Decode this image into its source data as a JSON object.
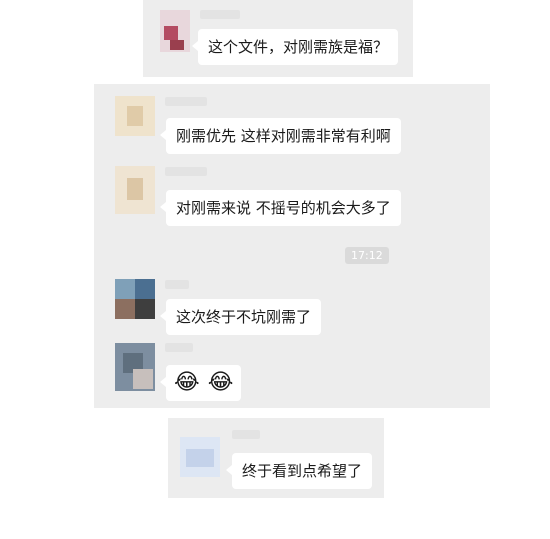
{
  "messages": [
    {
      "text": "这个文件，对刚需族是福？"
    },
    {
      "text": "刚需优先  这样对刚需非常有利啊"
    },
    {
      "text": "对刚需来说 不摇号的机会大多了"
    },
    {
      "text": "这次终于不坑刚需了"
    },
    {
      "emojis": [
        "😂",
        "😂"
      ]
    },
    {
      "text": "终于看到点希望了"
    }
  ],
  "timestamp": "17:12"
}
